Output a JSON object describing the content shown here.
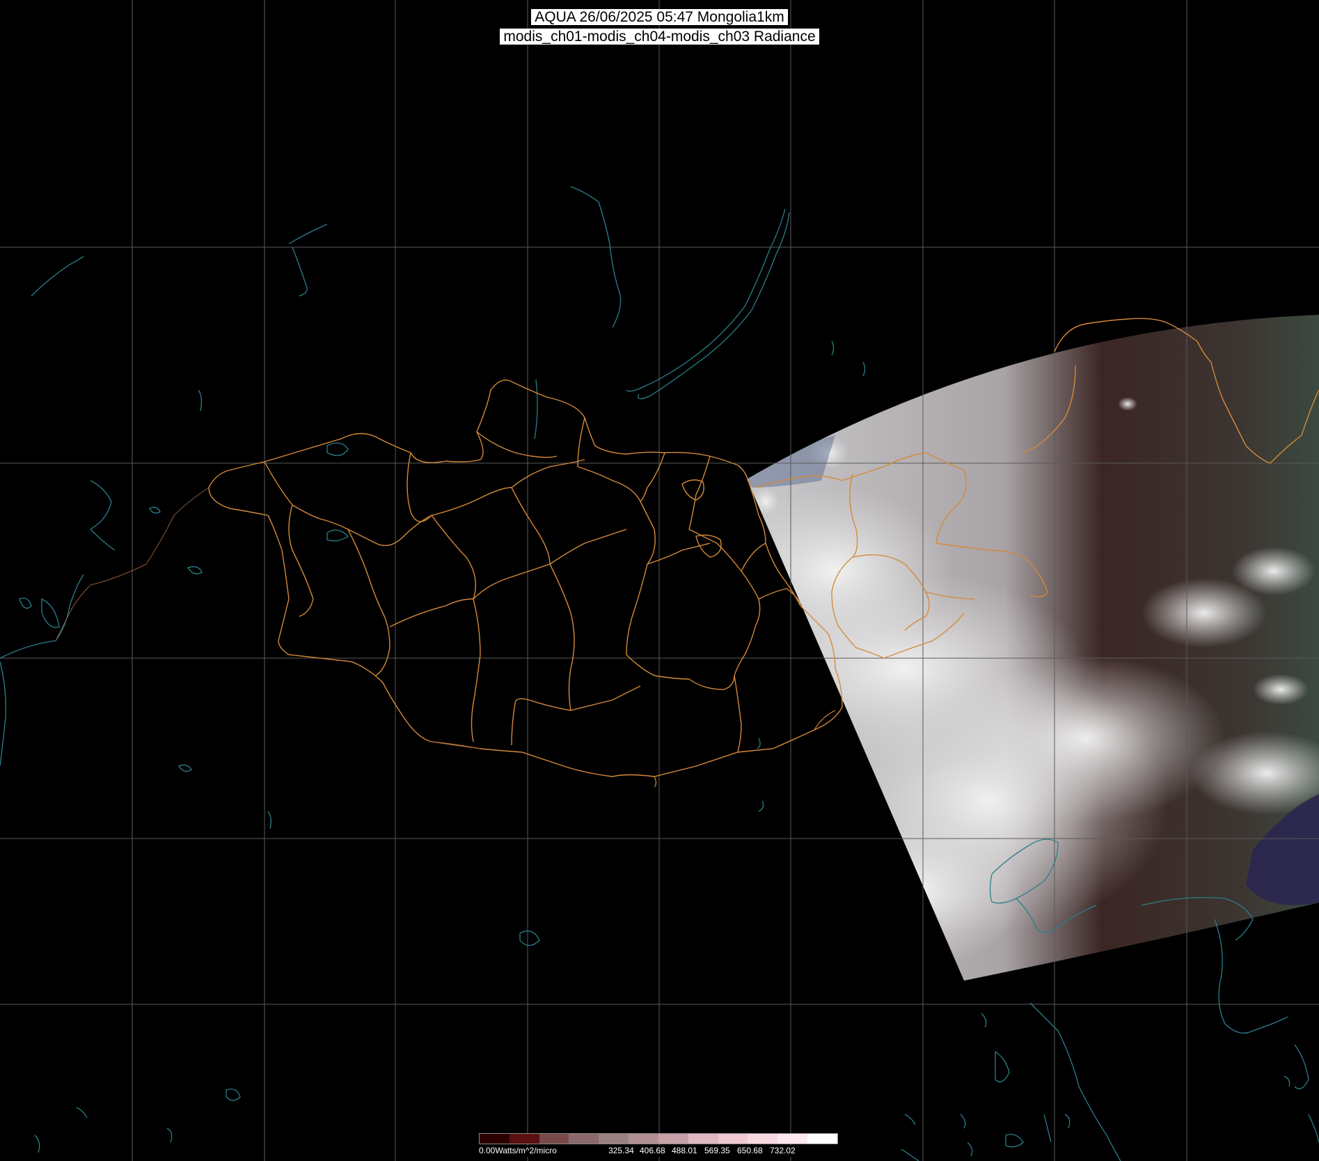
{
  "title": {
    "line1": "AQUA 26/06/2025 05:47 Mongolia1km",
    "line2": "modis_ch01-modis_ch04-modis_ch03 Radiance"
  },
  "legend": {
    "unit_label": "0.00Watts/m^2/micro",
    "ticks": [
      "325.34",
      "406.68",
      "488.01",
      "569.35",
      "650.68",
      "732.02"
    ],
    "colors": [
      "#2a0000",
      "#5a1010",
      "#7a4a4a",
      "#8a6a6a",
      "#9a8080",
      "#b09090",
      "#c8a0a8",
      "#e0b8c0",
      "#f0c8d0",
      "#f8d8e0",
      "#fce8ee",
      "#ffffff"
    ]
  },
  "colors": {
    "background": "#000000",
    "graticule": "#5a5a5a",
    "admin_border": "#d48a3a",
    "coast_water": "#2a7f8a",
    "cloud": "#e8e8e8",
    "land_dark": "#3a2624"
  }
}
